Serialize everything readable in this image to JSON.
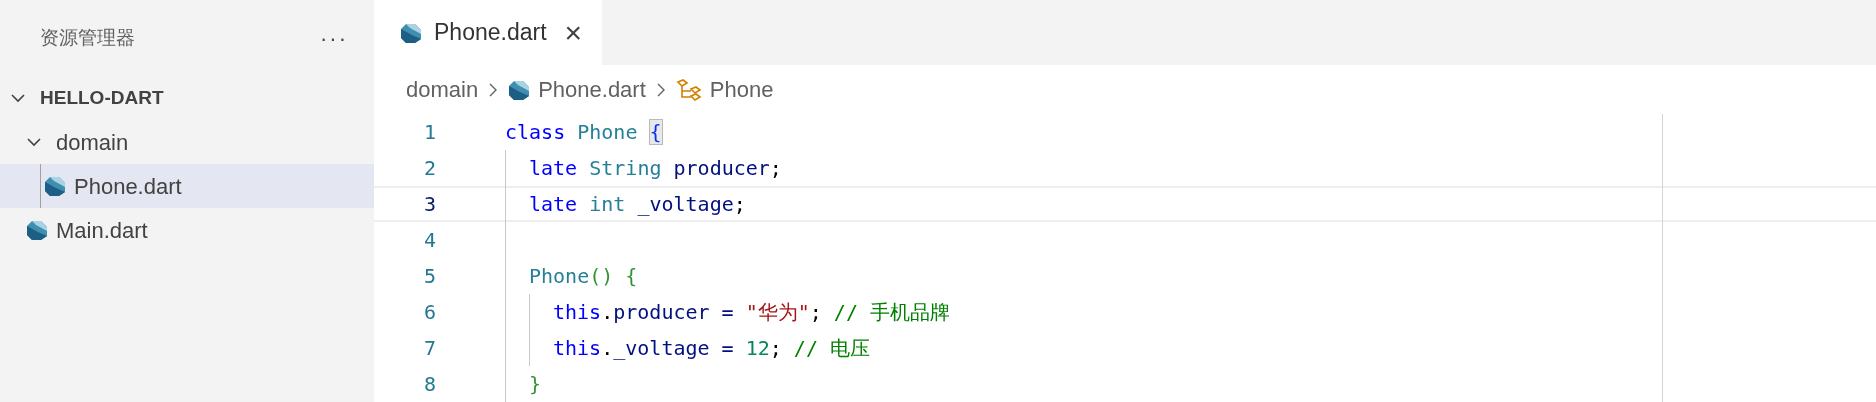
{
  "sidebar": {
    "title": "资源管理器",
    "more": "···",
    "tree": [
      {
        "label": "HELLO-DART",
        "kind": "root",
        "expanded": true,
        "selected": false,
        "children": [
          {
            "label": "domain",
            "kind": "folder",
            "expanded": true,
            "selected": false,
            "children": [
              {
                "label": "Phone.dart",
                "kind": "dart",
                "selected": true
              }
            ]
          },
          {
            "label": "Main.dart",
            "kind": "dart",
            "selected": false
          }
        ]
      }
    ]
  },
  "tabs": [
    {
      "label": "Phone.dart",
      "selected": true,
      "close": "×"
    }
  ],
  "breadcrumbs": [
    {
      "label": "domain",
      "kind": "folder"
    },
    {
      "label": "Phone.dart",
      "kind": "dart"
    },
    {
      "label": "Phone",
      "kind": "class"
    }
  ],
  "code": [
    {
      "number": "1",
      "current": false,
      "tokens": [
        {
          "text": "class ",
          "kind": "keyword"
        },
        {
          "text": "Phone ",
          "kind": "type"
        },
        {
          "text": "{",
          "kind": "bracket_match"
        }
      ],
      "children": [
        {
          "number": "2",
          "current": false,
          "tokens": [
            {
              "text": "late ",
              "kind": "keyword"
            },
            {
              "text": "String ",
              "kind": "type"
            },
            {
              "text": "producer",
              "kind": "ident"
            },
            {
              "text": ";",
              "kind": "punct"
            }
          ]
        },
        {
          "number": "3",
          "current": true,
          "tokens": [
            {
              "text": "late ",
              "kind": "keyword"
            },
            {
              "text": "int ",
              "kind": "type"
            },
            {
              "text": "_voltage",
              "kind": "ident"
            },
            {
              "text": ";",
              "kind": "punct"
            }
          ]
        },
        {
          "number": "4",
          "current": false
        },
        {
          "number": "5",
          "current": false,
          "tokens": [
            {
              "text": "Phone",
              "kind": "type"
            },
            {
              "text": "() {",
              "kind": "bracket"
            }
          ],
          "children": [
            {
              "number": "6",
              "current": false,
              "tokens": [
                {
                  "text": "this",
                  "kind": "keyword"
                },
                {
                  "text": ".",
                  "kind": "punct"
                },
                {
                  "text": "producer = ",
                  "kind": "ident"
                },
                {
                  "text": "\"华为\"",
                  "kind": "string"
                },
                {
                  "text": "; ",
                  "kind": "punct"
                },
                {
                  "text": "// 手机品牌",
                  "kind": "comment"
                }
              ]
            },
            {
              "number": "7",
              "current": false,
              "tokens": [
                {
                  "text": "this",
                  "kind": "keyword"
                },
                {
                  "text": ".",
                  "kind": "punct"
                },
                {
                  "text": "_voltage = ",
                  "kind": "ident"
                },
                {
                  "text": "12",
                  "kind": "number"
                },
                {
                  "text": "; ",
                  "kind": "punct"
                },
                {
                  "text": "// 电压",
                  "kind": "comment"
                }
              ]
            }
          ]
        },
        {
          "number": "8",
          "current": false,
          "tokens": [
            {
              "text": "}",
              "kind": "bracket"
            }
          ]
        }
      ]
    }
  ]
}
